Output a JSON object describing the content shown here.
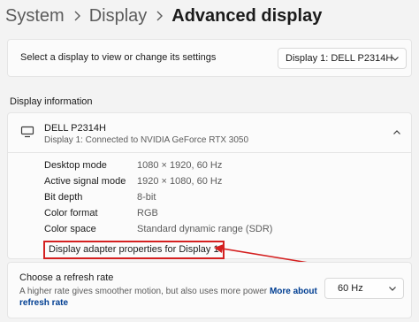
{
  "breadcrumb": {
    "items": [
      "System",
      "Display",
      "Advanced display"
    ]
  },
  "display_select": {
    "label": "Select a display to view or change its settings",
    "value": "Display 1: DELL P2314H"
  },
  "display_info": {
    "section_title": "Display information",
    "monitor_name": "DELL P2314H",
    "monitor_subtitle": "Display 1: Connected to NVIDIA GeForce RTX 3050",
    "properties": [
      {
        "label": "Desktop mode",
        "value": "1080 × 1920, 60 Hz"
      },
      {
        "label": "Active signal mode",
        "value": "1920 × 1080, 60 Hz"
      },
      {
        "label": "Bit depth",
        "value": "8-bit"
      },
      {
        "label": "Color format",
        "value": "RGB"
      },
      {
        "label": "Color space",
        "value": "Standard dynamic range (SDR)"
      }
    ],
    "adapter_link": "Display adapter properties for Display 1"
  },
  "refresh": {
    "title": "Choose a refresh rate",
    "description": "A higher rate gives smoother motion, but also uses more power",
    "more_link": "More about refresh rate",
    "value": "60 Hz"
  },
  "colors": {
    "highlight": "#d42020",
    "link": "#003e92",
    "background": "#f3f3f3",
    "card": "#fbfbfb"
  }
}
